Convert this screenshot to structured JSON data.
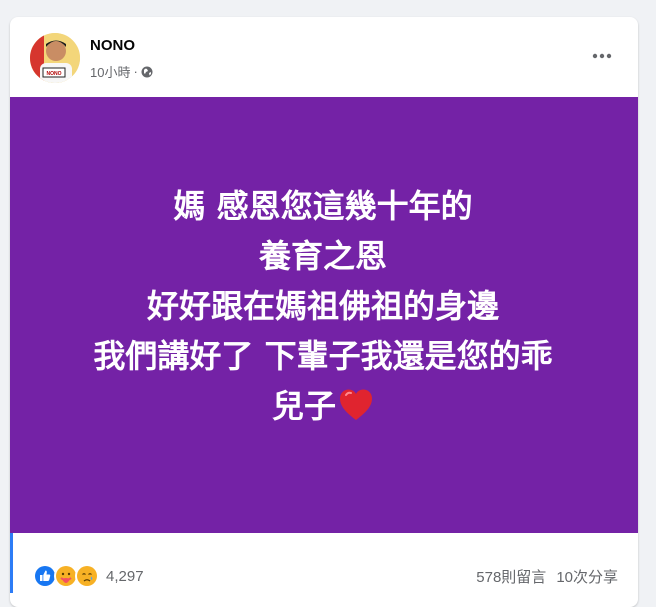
{
  "post": {
    "author": "NONO",
    "avatar_label": "NONO",
    "time": "10小時",
    "dot": "·",
    "privacy_icon": "globe-icon",
    "more_icon": "more-icon",
    "media_background": "#7422a6",
    "text_color": "#ffffff",
    "lines": [
      "媽 感恩您這幾十年的",
      "養育之恩",
      "好好跟在媽祖佛祖的身邊",
      "我們講好了 下輩子我還是您的乖",
      "兒子"
    ],
    "heart_emoji": "red-heart-emoji"
  },
  "footer": {
    "reactions": [
      "like-icon",
      "care-icon",
      "sad-icon"
    ],
    "reaction_count": "4,297",
    "comments": "578則留言",
    "shares": "10次分享"
  }
}
